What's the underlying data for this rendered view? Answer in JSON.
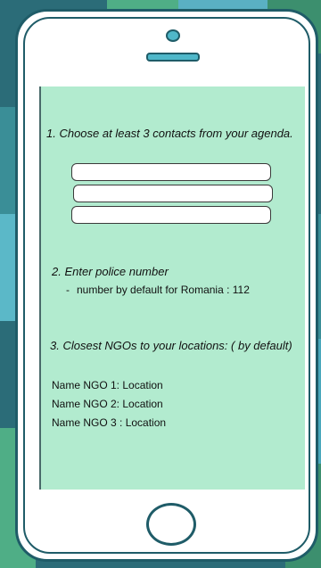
{
  "steps": {
    "step1_title": "1. Choose at least 3 contacts from your agenda.",
    "contacts": [
      "",
      "",
      ""
    ],
    "step2_title": "2.  Enter police number",
    "step2_dash": "-",
    "step2_hint": "number by default for Romania : 112",
    "step3_title": "3. Closest NGOs to your locations: ( by default)",
    "ngos": [
      "Name NGO  1: Location",
      "Name NGO 2: Location",
      "Name NGO 3 : Location"
    ]
  },
  "colors": {
    "screen_bg": "#b2ebcf",
    "phone_border": "#1f5c68",
    "accent": "#4fb7c9"
  },
  "icons": {
    "camera": "camera-icon",
    "speaker": "speaker-icon",
    "home": "home-button-icon"
  }
}
